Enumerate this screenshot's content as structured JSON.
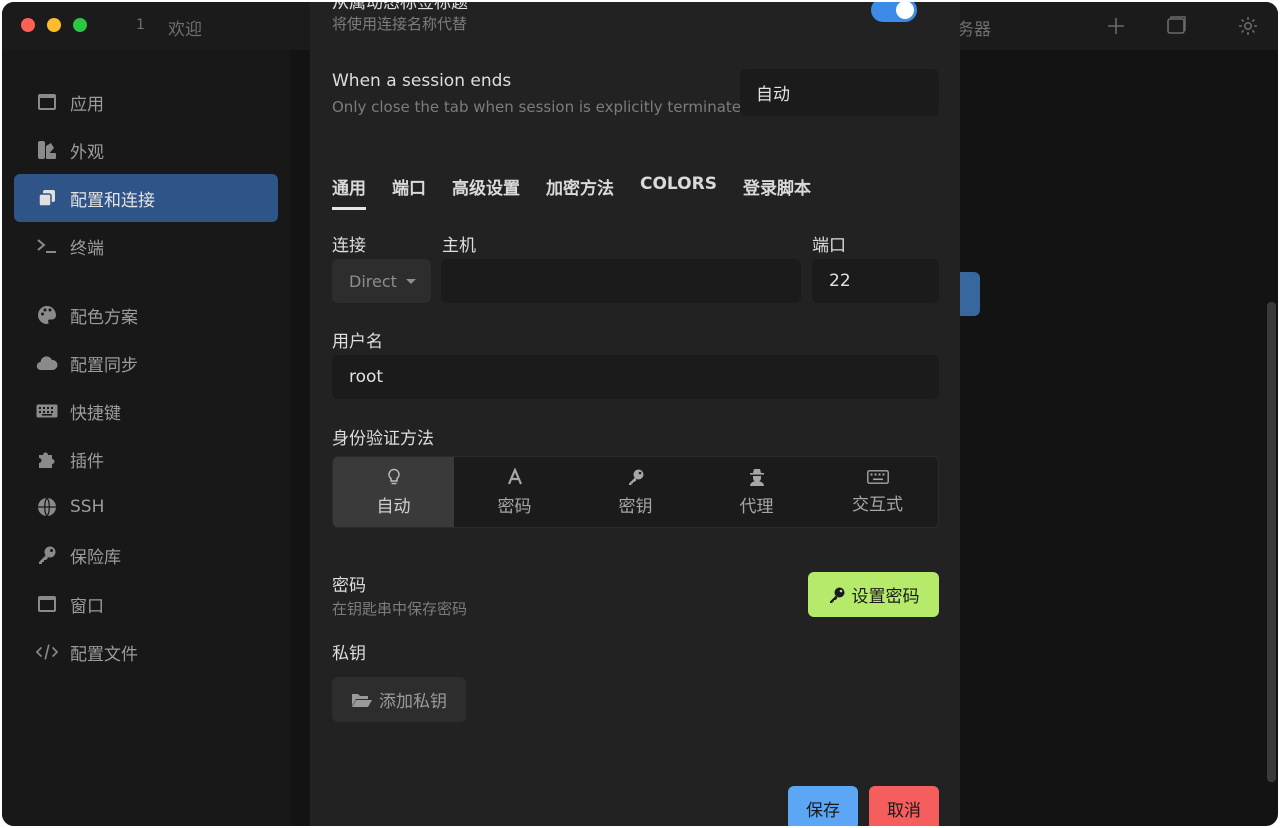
{
  "titlebar": {
    "tab_number": "1",
    "tab_title": "欢迎",
    "right_tab_fragment": "务器"
  },
  "sidebar": {
    "items": [
      {
        "label": "应用",
        "icon": "window-icon"
      },
      {
        "label": "外观",
        "icon": "palette-swatch-icon"
      },
      {
        "label": "配置和连接",
        "icon": "copy-icon",
        "active": true
      },
      {
        "label": "终端",
        "icon": "terminal-icon"
      },
      {
        "label": "配色方案",
        "icon": "palette-icon"
      },
      {
        "label": "配置同步",
        "icon": "cloud-icon"
      },
      {
        "label": "快捷键",
        "icon": "keyboard-icon"
      },
      {
        "label": "插件",
        "icon": "puzzle-icon"
      },
      {
        "label": "SSH",
        "icon": "globe-icon"
      },
      {
        "label": "保险库",
        "icon": "key-icon"
      },
      {
        "label": "窗口",
        "icon": "window-icon"
      },
      {
        "label": "配置文件",
        "icon": "code-icon"
      }
    ]
  },
  "modal": {
    "top_fragment_label": "从属动态标签标题",
    "top_fragment_sub": "将使用连接名称代替",
    "session_end_label": "When a session ends",
    "session_end_sub": "Only close the tab when session is explicitly terminated",
    "session_end_value": "自动",
    "tabs": [
      "通用",
      "端口",
      "高级设置",
      "加密方法",
      "COLORS",
      "登录脚本"
    ],
    "connection": {
      "label": "连接",
      "value": "Direct"
    },
    "host": {
      "label": "主机",
      "value": ""
    },
    "port": {
      "label": "端口",
      "value": "22"
    },
    "username": {
      "label": "用户名",
      "value": "root"
    },
    "auth": {
      "label": "身份验证方法",
      "options": [
        {
          "label": "自动",
          "icon": "lightbulb-icon",
          "active": true
        },
        {
          "label": "密码",
          "icon": "font-a-icon"
        },
        {
          "label": "密钥",
          "icon": "key-icon"
        },
        {
          "label": "代理",
          "icon": "user-secret-icon"
        },
        {
          "label": "交互式",
          "icon": "keyboard-icon"
        }
      ]
    },
    "password": {
      "label": "密码",
      "sub": "在钥匙串中保存密码",
      "button": "设置密码"
    },
    "private_key": {
      "label": "私钥",
      "button": "添加私钥"
    },
    "save_label": "保存",
    "cancel_label": "取消"
  },
  "colors": {
    "accent": "#3d8be8",
    "active_nav": "#2f5588",
    "set_password": "#b6ea6a",
    "save": "#5ba6f5",
    "cancel": "#f65d5d"
  }
}
